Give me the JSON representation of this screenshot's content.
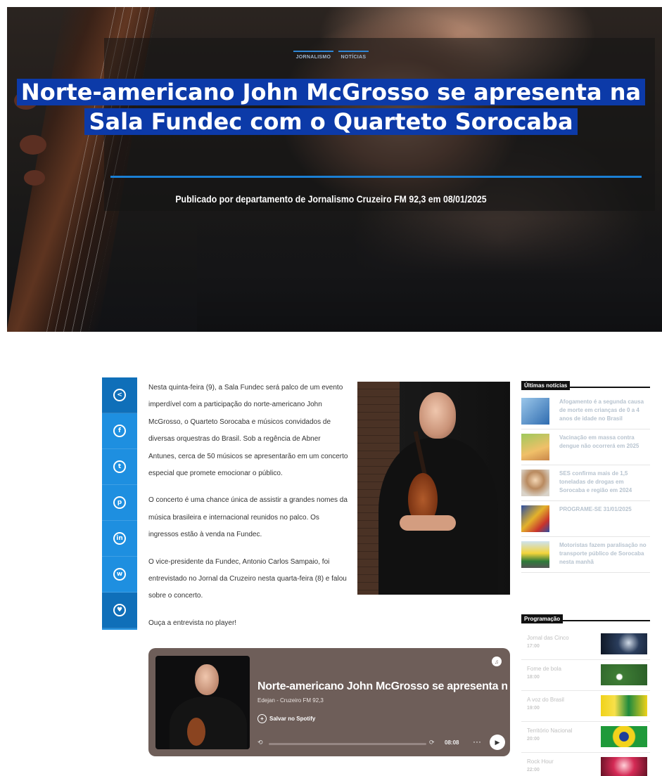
{
  "hero": {
    "categories": [
      "JORNALISMO",
      "NOTÍCIAS"
    ],
    "title": "Norte-americano John McGrosso se apresenta na Sala Fundec com o Quarteto Sorocaba",
    "byline": "Publicado por departamento de Jornalismo Cruzeiro FM 92,3 em 08/01/2025"
  },
  "share": {
    "icons": [
      "share-icon",
      "facebook-icon",
      "twitter-icon",
      "pinterest-icon",
      "linkedin-icon",
      "whatsapp-icon",
      "favorite-icon"
    ]
  },
  "article": {
    "paragraphs": [
      "Nesta quinta-feira (9), a Sala Fundec será palco de um evento imperdível com a participação do norte-americano John McGrosso, o Quarteto Sorocaba e músicos convidados de diversas orquestras do Brasil. Sob a regência de Abner Antunes, cerca de 50 músicos se apresentarão em um concerto especial que promete emocionar o público.",
      "O concerto é uma chance única de assistir a grandes nomes da música brasileira e internacional reunidos no palco. Os ingressos estão à venda na Fundec.",
      "O vice-presidente da Fundec, Antonio Carlos Sampaio, foi entrevistado no Jornal da Cruzeiro nesta quarta-feira (8) e falou sobre o concerto.",
      "Ouça a entrevista no player!"
    ]
  },
  "player": {
    "title": "Norte-americano John McGrosso se apresenta na Sala Fundec com o Quarteto Sorocaba",
    "subtitle": "Edejan - Cruzeiro FM 92,3",
    "save_label": "Salvar no Spotify",
    "time": "08:08",
    "more": "···"
  },
  "sidebar": {
    "latest_title": "Últimas notícias",
    "latest": [
      {
        "text": "Afogamento é a segunda causa de morte em crianças de 0 a 4 anos de idade no Brasil",
        "color": "#3f7fc4"
      },
      {
        "text": "Vacinação em massa contra dengue não ocorrerá em 2025",
        "color": "#e8b24a"
      },
      {
        "text": "SES confirma mais de 1,5 toneladas de drogas em Sorocaba e região em 2024",
        "color": "#b89a7a"
      },
      {
        "text": "PROGRAME-SE 31/01/2025",
        "color": "#3a60a8"
      },
      {
        "text": "Motoristas fazem paralisação no transporte público de Sorocaba nesta manhã",
        "color": "#d8c23a"
      }
    ],
    "schedule_title": "Programação",
    "schedule": [
      {
        "name": "Jornal das Cinco",
        "time": "17:00",
        "color": "#1b2d48"
      },
      {
        "name": "Fome de bola",
        "time": "18:00",
        "color": "#3f7a3a"
      },
      {
        "name": "A voz do Brasil",
        "time": "19:00",
        "color": "#e3c21c"
      },
      {
        "name": "Território Nacional",
        "time": "20:00",
        "color": "#1f9a3a"
      },
      {
        "name": "Rock Hour",
        "time": "22:00",
        "color": "#c2304c"
      }
    ]
  }
}
